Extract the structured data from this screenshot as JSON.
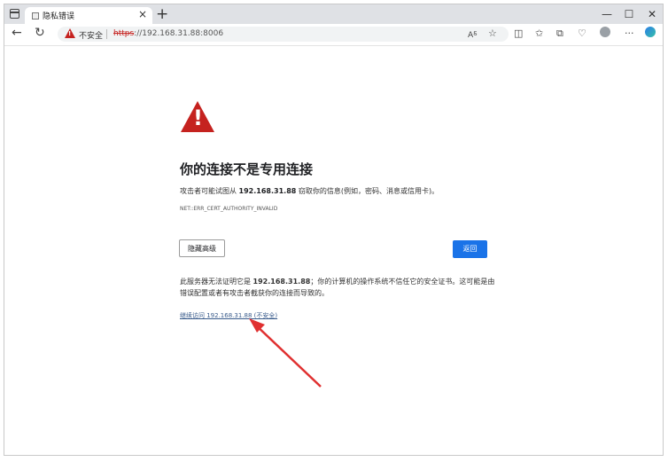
{
  "browser": {
    "tab_title": "隐私错误",
    "tab_close": "×",
    "new_tab": "+",
    "window_controls": {
      "minimize": "—",
      "maximize": "☐",
      "close": "✕"
    }
  },
  "toolbar": {
    "back": "←",
    "refresh": "↻",
    "security_label": "不安全",
    "url_scheme": "https",
    "url_rest": "://192.168.31.88:8006",
    "icons": [
      "read-aloud-icon",
      "favorite-add-icon",
      "split-screen-icon",
      "favorites-icon",
      "collections-icon",
      "browser-essentials-icon",
      "profile-icon",
      "more-icon",
      "copilot-icon"
    ]
  },
  "page": {
    "headline": "你的连接不是专用连接",
    "desc_prefix": "攻击者可能试图从 ",
    "desc_host": "192.168.31.88",
    "desc_suffix": " 窃取你的信息(例如，密码、消息或信用卡)。",
    "error_code": "NET::ERR_CERT_AUTHORITY_INVALID",
    "advanced_button": "隐藏高级",
    "back_button": "返回",
    "detail_prefix": "此服务器无法证明它是 ",
    "detail_host": "192.168.31.88",
    "detail_suffix": "；你的计算机的操作系统不信任它的安全证书。这可能是由错误配置或者有攻击者截获你的连接而导致的。",
    "proceed_link": "继续访问 192.168.31.88 (不安全)"
  },
  "colors": {
    "danger": "#c5221f",
    "primary": "#1a73e8",
    "annotation_arrow": "#e03030"
  }
}
